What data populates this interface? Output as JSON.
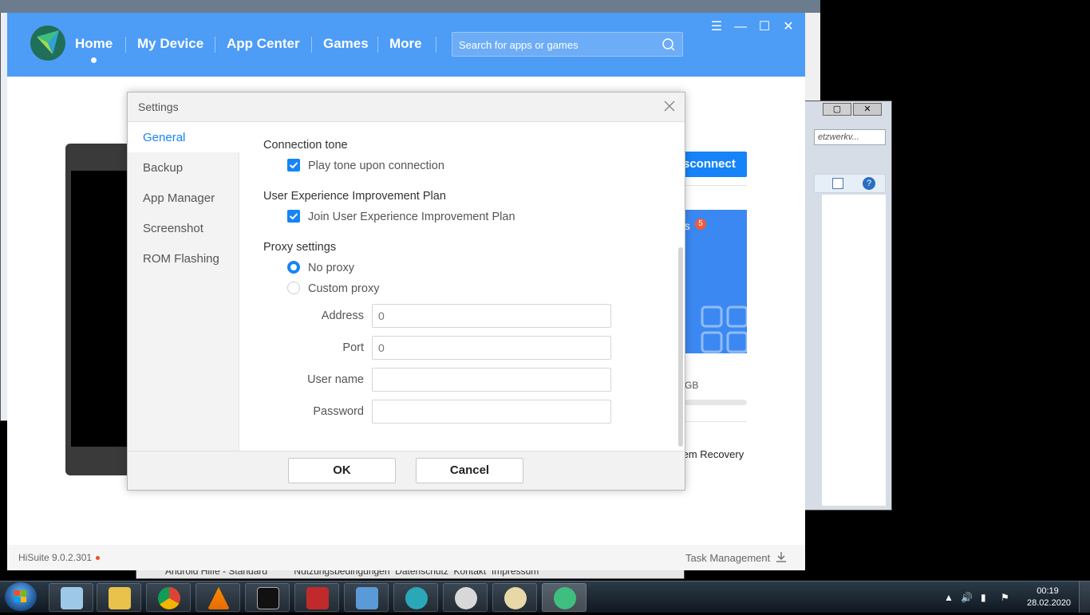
{
  "app": {
    "nav": [
      "Home",
      "My Device",
      "App Center",
      "Games",
      "More"
    ],
    "search_placeholder": "Search for apps or games",
    "disconnect_label": "Disconnect",
    "disconnect_visible": "sconnect",
    "badge_count": "5",
    "storage_unit": "GB",
    "recovery_label": "tem Recovery",
    "version": "HiSuite 9.0.2.301",
    "task_management": "Task Management"
  },
  "settings": {
    "title": "Settings",
    "sidebar": [
      "General",
      "Backup",
      "App Manager",
      "Screenshot",
      "ROM Flashing"
    ],
    "active_tab": "General",
    "connection_tone": {
      "title": "Connection tone",
      "option": "Play tone upon connection",
      "checked": true
    },
    "ux_plan": {
      "title": "User Experience Improvement Plan",
      "option": "Join User Experience Improvement Plan",
      "checked": true
    },
    "proxy": {
      "title": "Proxy settings",
      "no_proxy": "No proxy",
      "custom_proxy": "Custom proxy",
      "selected": "No proxy",
      "fields": {
        "address_label": "Address",
        "address_placeholder": "0",
        "port_label": "Port",
        "port_placeholder": "0",
        "username_label": "User name",
        "password_label": "Password"
      }
    },
    "ok": "OK",
    "cancel": "Cancel"
  },
  "background": {
    "search_text": "etzwerkv...",
    "bottom_window_text": "Android Hilfe - Standard          Nutzungsbedingungen  Datenschutz  Kontakt  Impressum"
  },
  "taskbar": {
    "time": "00:19",
    "date": "28.02.2020"
  },
  "colors": {
    "accent": "#1684f8",
    "topbar": "#4d9cf6"
  }
}
